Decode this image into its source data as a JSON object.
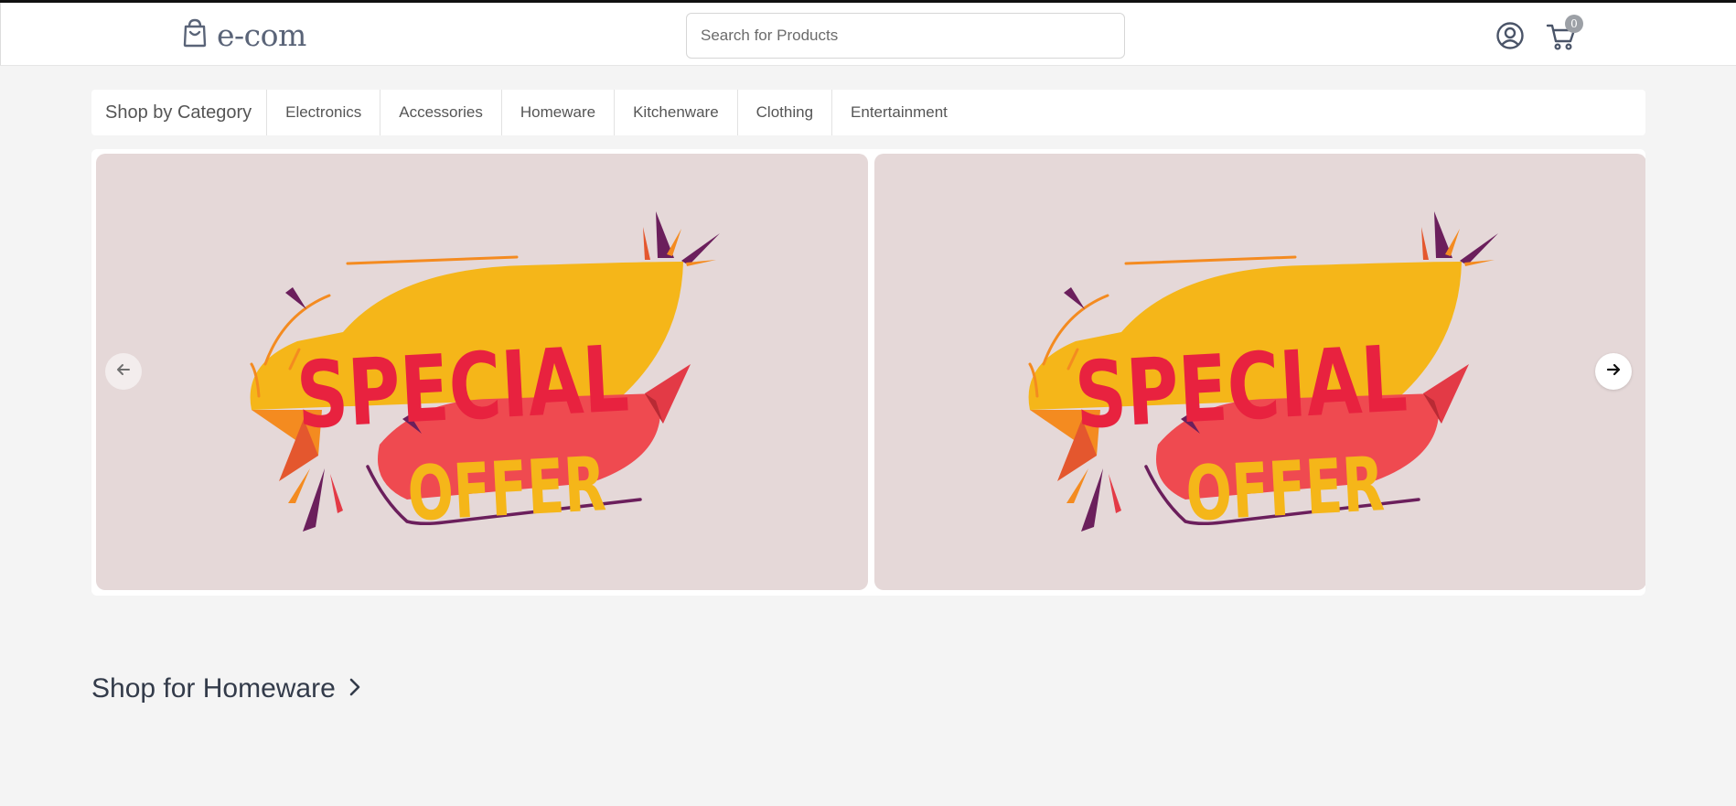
{
  "header": {
    "logo_text": "e-com",
    "search_placeholder": "Search for Products",
    "cart_count": "0"
  },
  "categories": {
    "title": "Shop by Category",
    "items": [
      "Electronics",
      "Accessories",
      "Homeware",
      "Kitchenware",
      "Clothing",
      "Entertainment"
    ]
  },
  "carousel": {
    "slides": [
      {
        "line1": "SPECIAL",
        "line2": "OFFER"
      },
      {
        "line1": "SPECIAL",
        "line2": "OFFER"
      }
    ]
  },
  "section": {
    "title": "Shop for Homeware"
  },
  "icons": {
    "logo": "shopping-bag-icon",
    "user": "user-circle-icon",
    "cart": "cart-icon",
    "prev": "arrow-left-icon",
    "next": "arrow-right-icon",
    "section": "chevron-right-icon"
  },
  "colors": {
    "slide_bg": "#e5d8d8",
    "banner_yellow": "#f5b619",
    "banner_red": "#ef4a50",
    "text_red": "#e8223f",
    "accent_purple": "#6b1f5c"
  }
}
